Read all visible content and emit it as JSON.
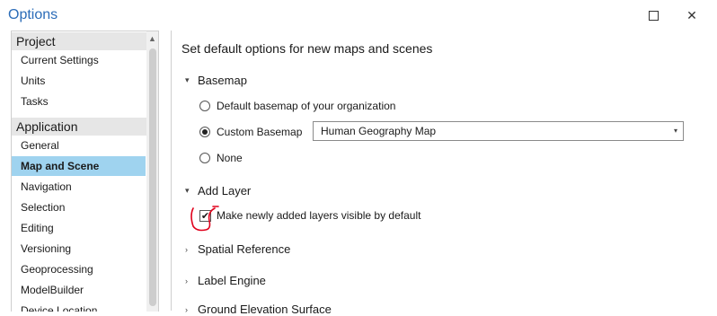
{
  "window": {
    "title": "Options"
  },
  "sidebar": {
    "groups": [
      {
        "label": "Project",
        "items": [
          "Current Settings",
          "Units",
          "Tasks"
        ]
      },
      {
        "label": "Application",
        "items": [
          "General",
          "Map and Scene",
          "Navigation",
          "Selection",
          "Editing",
          "Versioning",
          "Geoprocessing",
          "ModelBuilder",
          "Device Location"
        ]
      }
    ],
    "selected": "Map and Scene"
  },
  "main": {
    "heading": "Set default options for new maps and scenes",
    "basemap": {
      "label": "Basemap",
      "options": [
        "Default basemap of your organization",
        "Custom Basemap",
        "None"
      ],
      "selected": "Custom Basemap",
      "dropdown_value": "Human Geography Map"
    },
    "add_layer": {
      "label": "Add Layer",
      "checkbox_label": "Make newly added layers visible by default",
      "checked": true
    },
    "collapsed_sections": [
      "Spatial Reference",
      "Label Engine",
      "Ground Elevation Surface"
    ]
  },
  "accent_color": "#2b6cb8",
  "selection_color": "#9fd3ef",
  "annotation_color": "#e0001b"
}
